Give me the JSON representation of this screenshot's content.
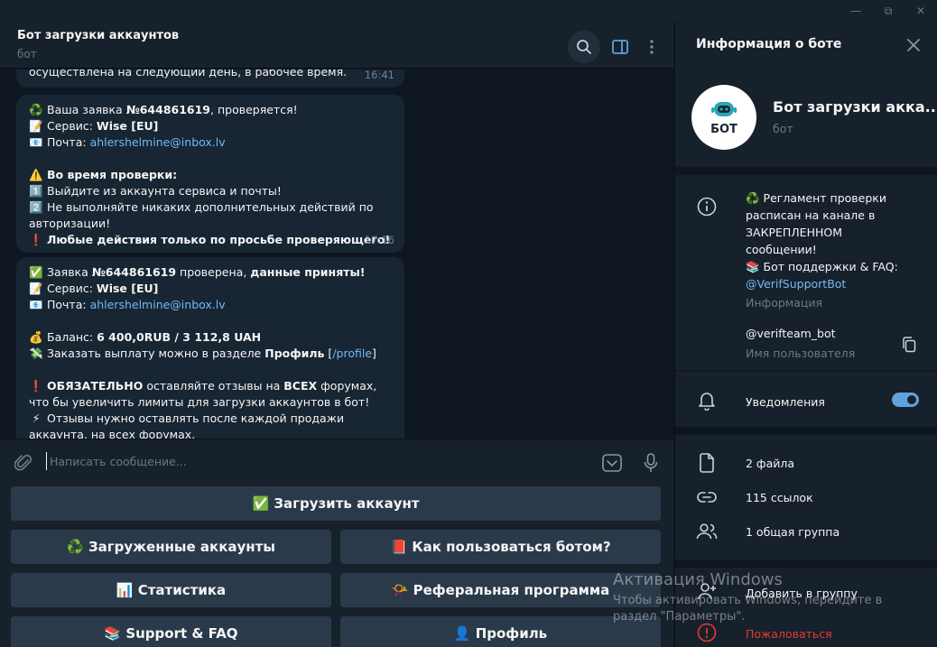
{
  "window": {
    "minimize": "—",
    "restore": "⧉",
    "close": "✕"
  },
  "chat": {
    "title": "Бот загрузки аккаунтов",
    "subtitle": "бот"
  },
  "messages": [
    {
      "lines": [
        "осуществлена на следующий день, в рабочее время."
      ],
      "time": "16:41"
    },
    {
      "l1_pre": "Ваша заявка ",
      "l1_b": "№644861619",
      "l1_post": ", проверяется!",
      "l2_pre": "Сервис: ",
      "l2_b": "Wise [EU]",
      "l3_pre": "Почта: ",
      "l3_link": "ahlershelmine@inbox.lv",
      "l4_b": "Во время проверки:",
      "l5": "Выйдите из аккаунта сервиса и почты!",
      "l6": "Не выполняйте никаких дополнительных действий по авторизации!",
      "l7_b": "Любые действия только по просьбе проверяющего!",
      "time": "17:16"
    },
    {
      "l1_pre": "Заявка ",
      "l1_b": "№644861619",
      "l1_mid": " проверена, ",
      "l1_b2": "данные приняты!",
      "l2_pre": "Сервис: ",
      "l2_b": "Wise [EU]",
      "l3_pre": "Почта: ",
      "l3_link": "ahlershelmine@inbox.lv",
      "l4_pre": "Баланс: ",
      "l4_b": "6 400,0RUB  / 3 112,8 UAH",
      "l5_pre": "Заказать выплату можно в разделе ",
      "l5_b": "Профиль",
      "l5_mid": " [",
      "l5_link": "/profile",
      "l5_post": "]",
      "l6_b": "ОБЯЗАТЕЛЬНО",
      "l6_mid": " оставляйте отзывы на ",
      "l6_b2": "ВСЕХ",
      "l6_post": " форумах, что бы увеличить лимиты для загрузки аккаунтов в бот!",
      "l7": "Отзывы нужно оставлять после каждой продажи аккаунта, на всех форумах."
    }
  ],
  "input": {
    "placeholder": "Написать сообщение..."
  },
  "keyboard": {
    "upload": "✅ Загрузить аккаунт",
    "uploaded": "♻️ Загруженные аккаунты",
    "howto": "📕 Как пользоваться ботом?",
    "stats": "📊 Статистика",
    "referral": "📯 Реферальная программа",
    "support": "📚 Support & FAQ",
    "profile": "👤 Профиль"
  },
  "panel": {
    "title": "Информация о боте",
    "avatar_text": "БОТ",
    "name": "Бот загрузки акка...",
    "sub": "бот",
    "info_lines": [
      "♻️ Регламент проверки",
      "расписан на канале в",
      "ЗАКРЕПЛЕННОМ",
      "сообщении!",
      "📚 Бот поддержки & FAQ:"
    ],
    "info_link": "@VerifSupportBot",
    "info_label": "Информация",
    "username": "@verifteam_bot",
    "username_label": "Имя пользователя",
    "notifications": "Уведомления",
    "files": "2 файла",
    "links": "115 ссылок",
    "groups": "1 общая группа",
    "add_group": "Добавить в группу",
    "report": "Пожаловаться"
  },
  "watermark": {
    "line1": "Активация Windows",
    "line2": "Чтобы активировать Windows, перейдите в",
    "line3": "раздел \"Параметры\"."
  },
  "colors": {
    "accent": "#5fa3e0",
    "link": "#71baf5",
    "danger": "#e53935",
    "bubble": "#182533",
    "bg": "#0e1621"
  }
}
